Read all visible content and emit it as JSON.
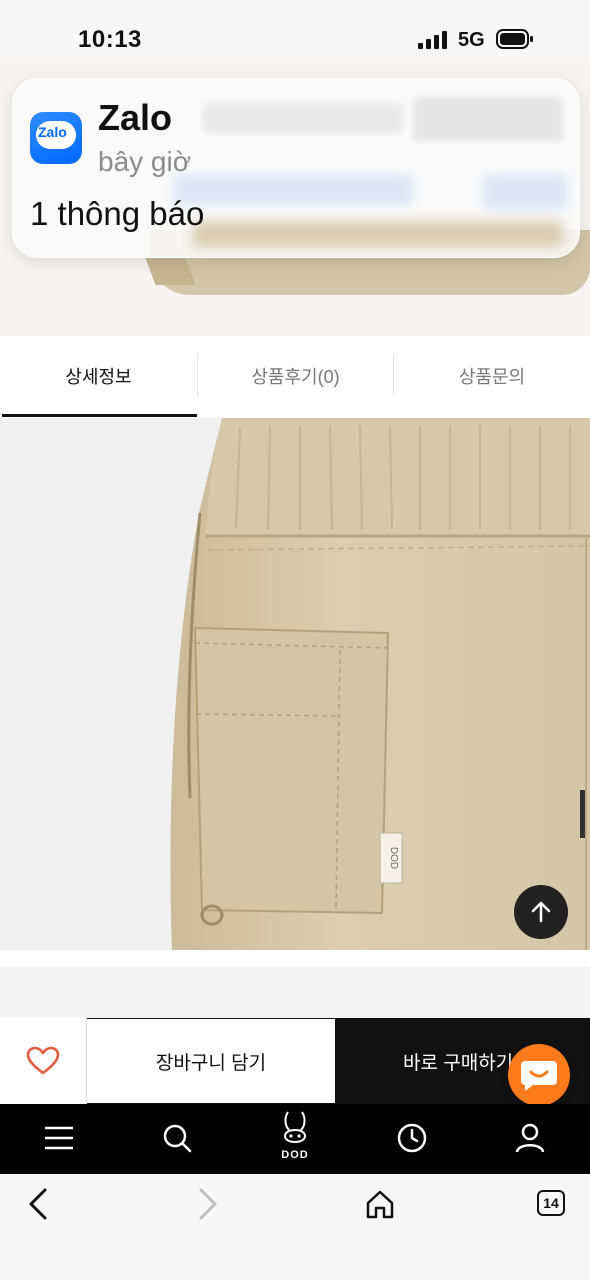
{
  "status_bar": {
    "time": "10:13",
    "network": "5G"
  },
  "notification": {
    "app_icon_text": "Zalo",
    "app_name": "Zalo",
    "time": "bây giờ",
    "message": "1 thông báo"
  },
  "tabs": [
    {
      "label": "상세정보",
      "active": true
    },
    {
      "label": "상품후기(0)",
      "active": false
    },
    {
      "label": "상품문의",
      "active": false
    }
  ],
  "product_image": {
    "label_text": "DOD"
  },
  "buy_bar": {
    "wish_icon": "heart-icon",
    "cart_label": "장바구니 담기",
    "buy_label": "바로 구매하기"
  },
  "site_nav": {
    "logo_text": "DOD",
    "icons": [
      "menu-icon",
      "search-icon",
      "logo",
      "clock-icon",
      "user-icon"
    ]
  },
  "browser": {
    "tab_count": "14"
  },
  "colors": {
    "accent_orange": "#ff7a1a",
    "fabric": "#d8c9aa",
    "zalo_blue": "#0068ff"
  }
}
